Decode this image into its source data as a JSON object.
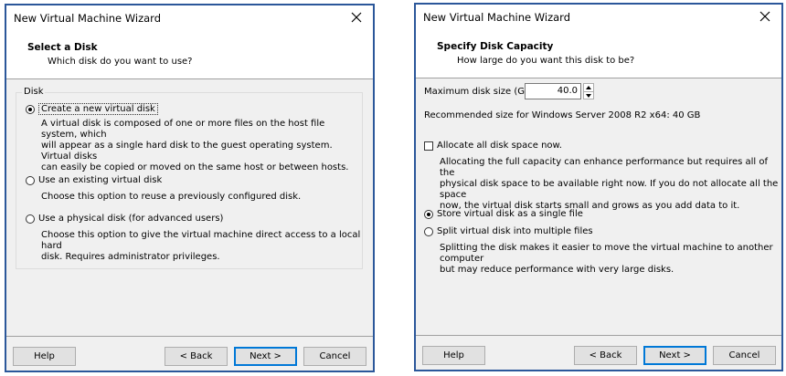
{
  "left_dialog": {
    "title": "New Virtual Machine Wizard",
    "header_title": "Select a Disk",
    "header_subtitle": "Which disk do you want to use?",
    "group_label": "Disk",
    "options": [
      {
        "label": "Create a new virtual disk",
        "selected": true,
        "desc": [
          "A virtual disk is composed of one or more files on the host file system, which",
          "will appear as a single hard disk to the guest operating system. Virtual disks",
          "can easily be copied or moved on the same host or between hosts."
        ]
      },
      {
        "label": "Use an existing virtual disk",
        "selected": false,
        "desc": [
          "Choose this option to reuse a previously configured disk."
        ]
      },
      {
        "label": "Use a physical disk (for advanced users)",
        "selected": false,
        "desc": [
          "Choose this option to give the virtual machine direct access to a local hard",
          "disk. Requires administrator privileges."
        ]
      }
    ],
    "buttons": {
      "help": "Help",
      "back": "< Back",
      "next": "Next >",
      "cancel": "Cancel"
    }
  },
  "right_dialog": {
    "title": "New Virtual Machine Wizard",
    "header_title": "Specify Disk Capacity",
    "header_subtitle": "How large do you want this disk to be?",
    "max_size_label": "Maximum disk size (GB):",
    "max_size_value": "40.0",
    "recommended": "Recommended size for Windows Server 2008 R2 x64: 40 GB",
    "allocate_label": "Allocate all disk space now.",
    "allocate_checked": false,
    "allocate_desc": [
      "Allocating the full capacity can enhance performance but requires all of the",
      "physical disk space to be available right now. If you do not allocate all the space",
      "now, the virtual disk starts small and grows as you add data to it."
    ],
    "store_options": [
      {
        "label": "Store virtual disk as a single file",
        "selected": true
      },
      {
        "label": "Split virtual disk into multiple files",
        "selected": false
      }
    ],
    "split_desc": [
      "Splitting the disk makes it easier to move the virtual machine to another computer",
      "but may reduce performance with very large disks."
    ],
    "buttons": {
      "help": "Help",
      "back": "< Back",
      "next": "Next >",
      "cancel": "Cancel"
    }
  },
  "icons": {
    "close": "close-icon",
    "spin_up": "spin-up-icon",
    "spin_down": "spin-down-icon"
  },
  "colors": {
    "window_border": "#2b579a",
    "default_button": "#0078d7",
    "dialog_bg": "#f0f0f0"
  }
}
